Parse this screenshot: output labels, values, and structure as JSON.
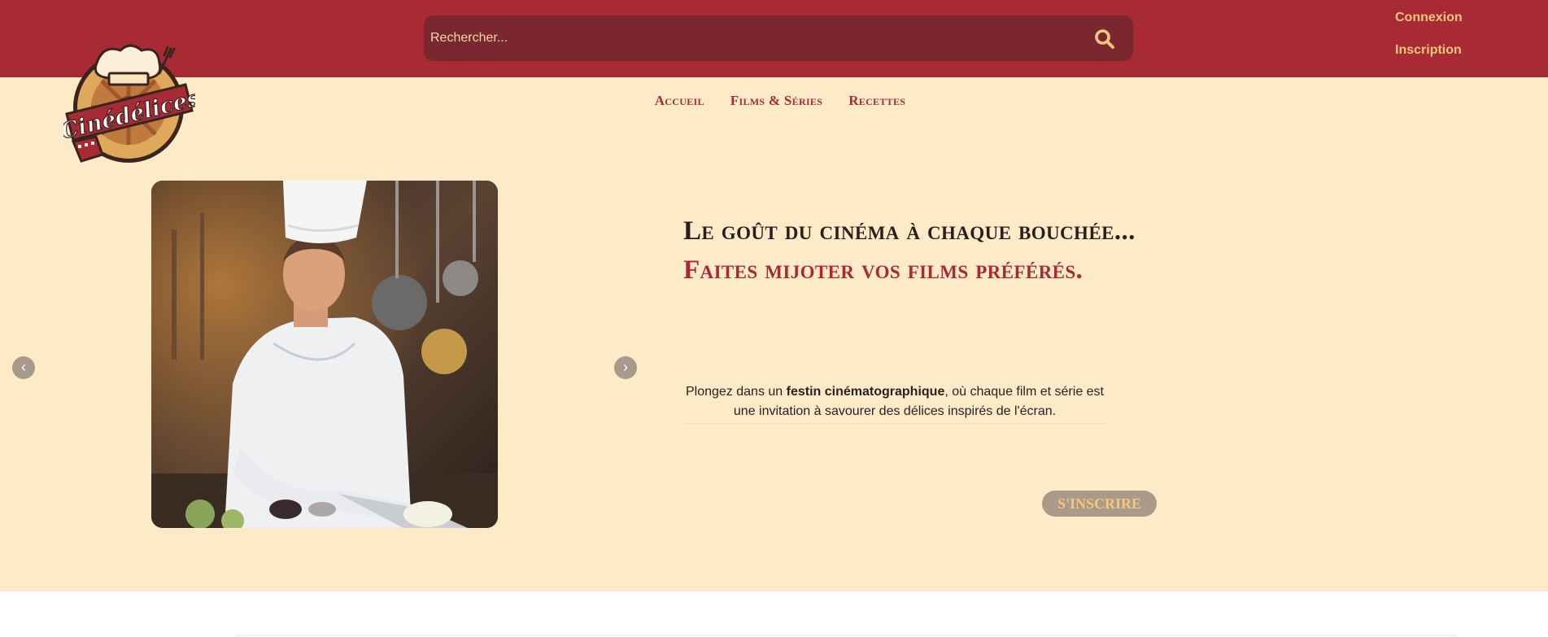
{
  "header": {
    "search": {
      "placeholder": "Rechercher..."
    },
    "auth": {
      "login_label": "Connexion",
      "signup_label": "Inscription"
    }
  },
  "nav": {
    "items": [
      {
        "label": "Accueil"
      },
      {
        "label": "Films & Séries"
      },
      {
        "label": "Recettes"
      }
    ]
  },
  "logo": {
    "text": "Cinédélices"
  },
  "hero": {
    "carousel": {
      "prev_glyph": "‹",
      "next_glyph": "›"
    },
    "headline_line1": "Le goût du cinéma à chaque bouchée...",
    "headline_line2": "Faites mijoter vos films préférés.",
    "paragraph": {
      "before": "Plongez dans un ",
      "bold": "festin cinématographique",
      "after": ", où chaque film et série est une invitation à savourer des délices inspirés de l'écran."
    },
    "cta_label": "S'INSCRIRE"
  },
  "colors": {
    "brand_red": "#a82a35",
    "search_bg": "#7b2730",
    "cream": "#fdebc8",
    "gold": "#f3c77c"
  },
  "icons": {
    "search": "magnifier-icon",
    "logo": "logo-emblem"
  }
}
